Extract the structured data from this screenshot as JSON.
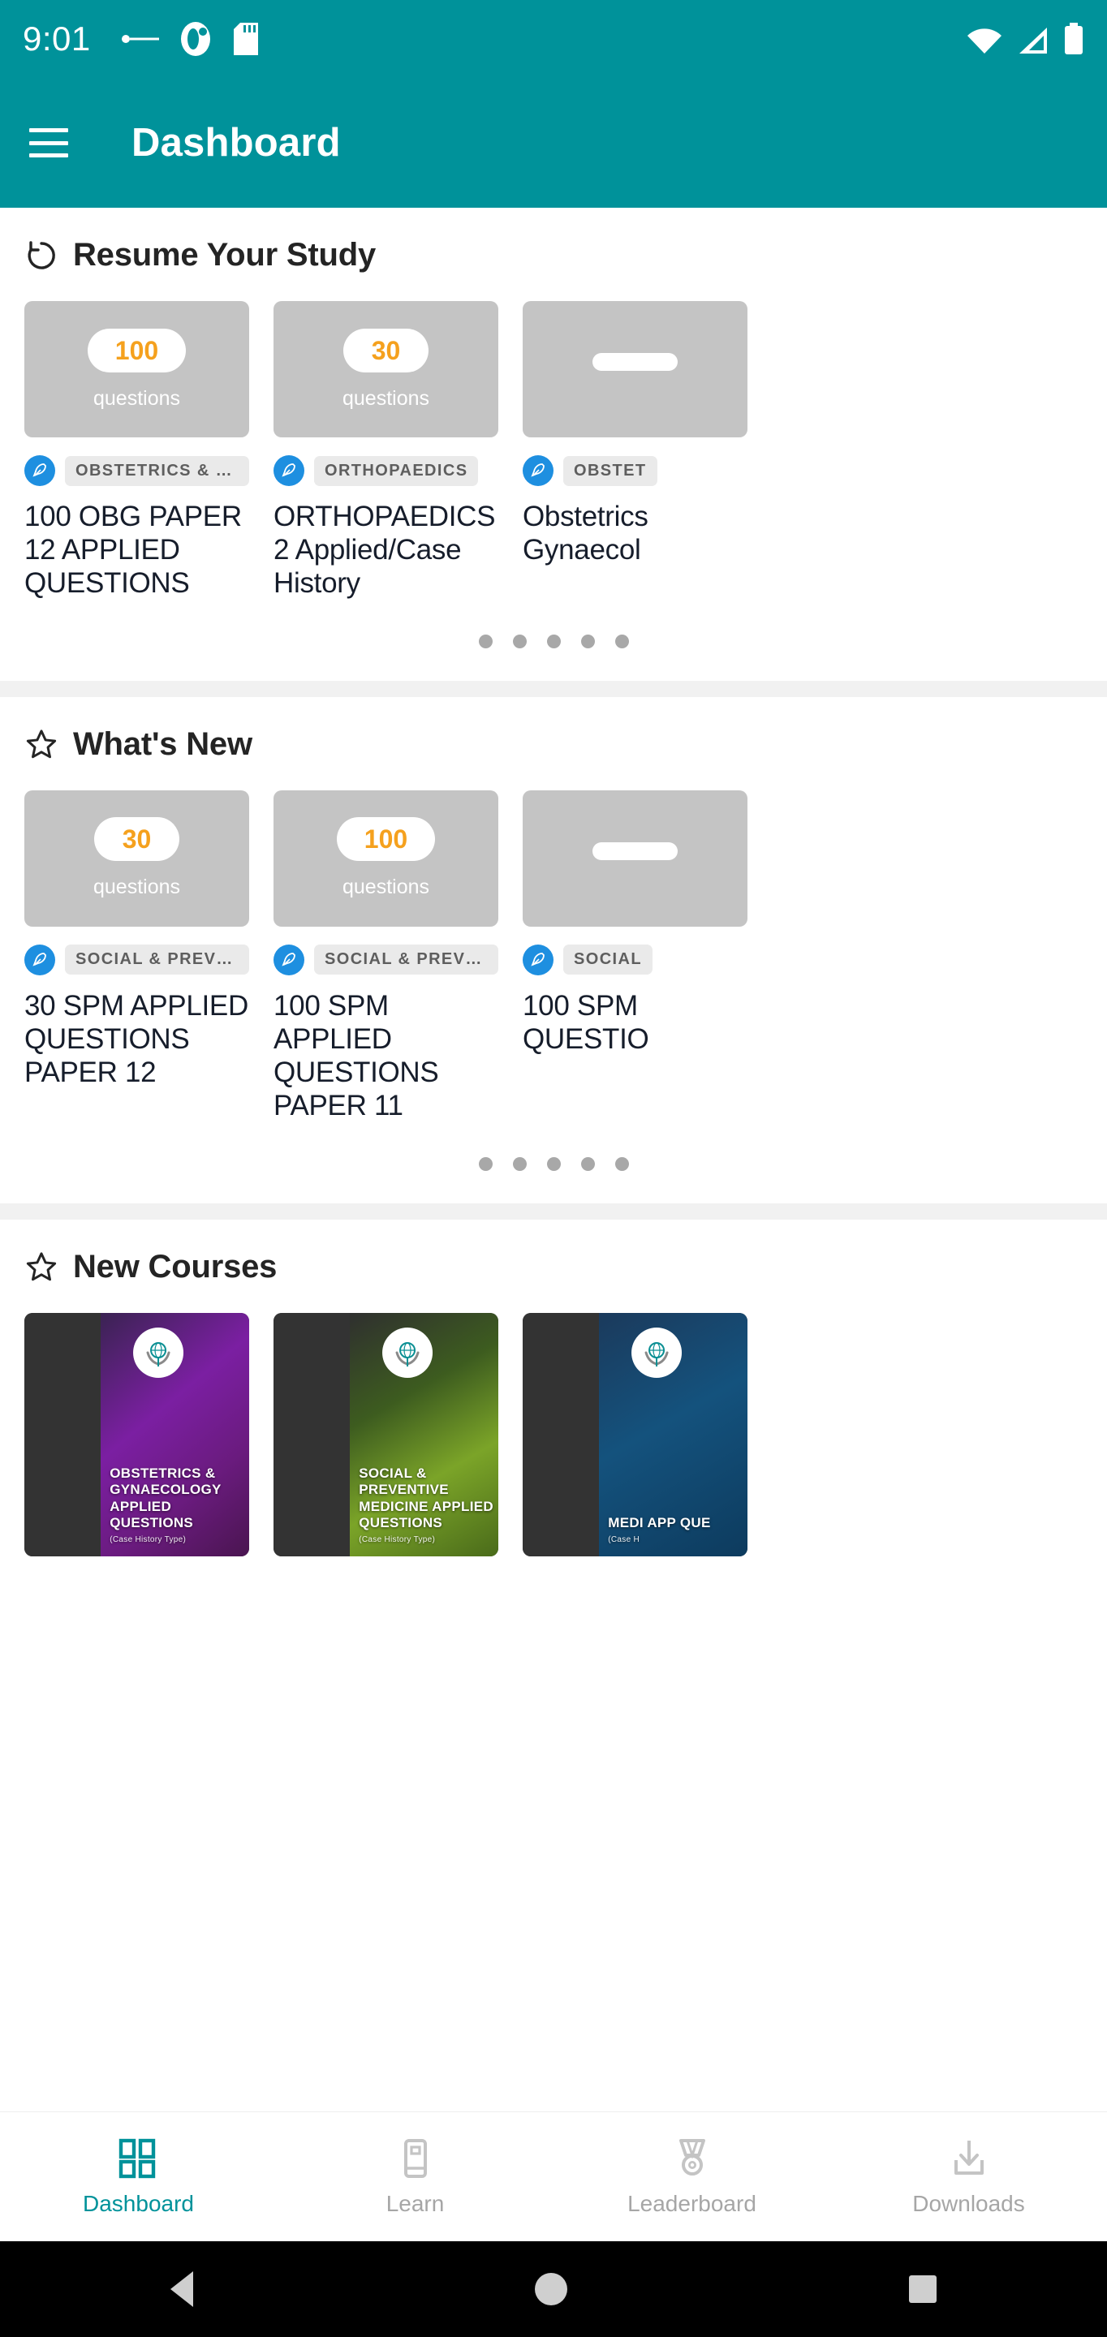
{
  "status_bar": {
    "time": "9:01",
    "icons": [
      "notification-dash-icon",
      "app-notification-icon",
      "sd-card-icon"
    ],
    "right_icons": [
      "wifi-icon",
      "cellular-signal-icon",
      "battery-icon"
    ]
  },
  "app_bar": {
    "menu_icon": "hamburger-menu-icon",
    "title": "Dashboard"
  },
  "colors": {
    "primary": "#00929A",
    "accent_orange": "#F5A11E",
    "chip_blue": "#1E8FE0",
    "thumb_gray": "#c4c4c4",
    "dot_gray": "#a8a8a8"
  },
  "sections": [
    {
      "id": "resume-your-study",
      "icon": "restore-rotate-icon",
      "title": "Resume Your Study",
      "cards": [
        {
          "count": "100",
          "count_label": "questions",
          "badge_icon": "feather-pen-icon",
          "chip": "OBSTETRICS & GYNAECOLO…",
          "title": "100 OBG PAPER 12 APPLIED QUESTIONS"
        },
        {
          "count": "30",
          "count_label": "questions",
          "badge_icon": "feather-pen-icon",
          "chip": "ORTHOPAEDICS",
          "title": "ORTHOPAEDICS 2 Applied/Case History"
        },
        {
          "count": "",
          "count_label": "",
          "badge_icon": "feather-pen-icon",
          "chip": "OBSTET",
          "title": "Obstetrics Gynaecol"
        }
      ],
      "dots": 5
    },
    {
      "id": "whats-new",
      "icon": "star-outline-icon",
      "title": "What's New",
      "cards": [
        {
          "count": "30",
          "count_label": "questions",
          "badge_icon": "feather-pen-icon",
          "chip": "SOCIAL & PREVENTIVE MEDI",
          "title": "30 SPM APPLIED QUESTIONS PAPER 12"
        },
        {
          "count": "100",
          "count_label": "questions",
          "badge_icon": "feather-pen-icon",
          "chip": "SOCIAL & PREVENTIVE MEDI",
          "title": "100 SPM APPLIED QUESTIONS PAPER 11"
        },
        {
          "count": "",
          "count_label": "",
          "badge_icon": "feather-pen-icon",
          "chip": "SOCIAL",
          "title": "100 SPM QUESTIO"
        }
      ],
      "dots": 5
    },
    {
      "id": "new-courses",
      "icon": "star-outline-icon",
      "title": "New Courses",
      "courses": [
        {
          "title": "OBSTETRICS & GYNAECOLOGY APPLIED QUESTIONS",
          "subtitle": "(Case History Type)",
          "logo": "institute-globe-hands-logo"
        },
        {
          "title": "SOCIAL & PREVENTIVE MEDICINE APPLIED QUESTIONS",
          "subtitle": "(Case History Type)",
          "logo": "institute-globe-hands-logo"
        },
        {
          "title": "MEDI APP QUE",
          "subtitle": "(Case H",
          "logo": "institute-globe-hands-logo"
        }
      ]
    }
  ],
  "bottom_nav": [
    {
      "label": "Dashboard",
      "icon": "grid-dashboard-icon",
      "active": true
    },
    {
      "label": "Learn",
      "icon": "book-learn-icon",
      "active": false
    },
    {
      "label": "Leaderboard",
      "icon": "trophy-medal-icon",
      "active": false
    },
    {
      "label": "Downloads",
      "icon": "download-arrow-icon",
      "active": false
    }
  ],
  "system_nav": {
    "back": "back-triangle-icon",
    "home": "home-circle-icon",
    "recents": "recents-square-icon"
  }
}
